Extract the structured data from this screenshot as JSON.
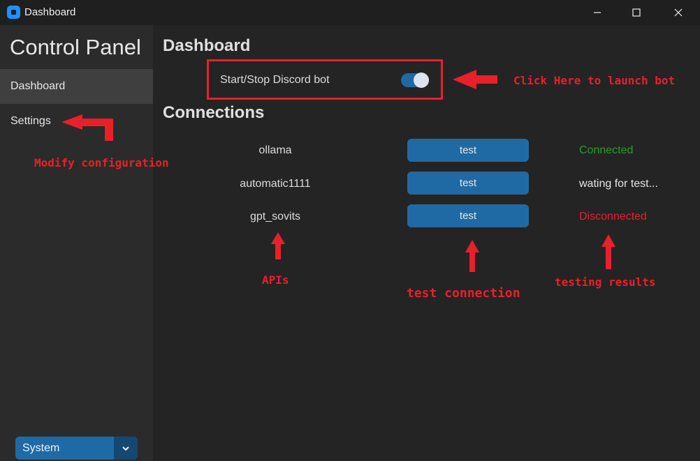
{
  "window": {
    "title": "Dashboard",
    "icon": "app-icon",
    "controls": [
      "minimize-icon",
      "maximize-icon",
      "close-icon"
    ]
  },
  "sidebar": {
    "title": "Control Panel",
    "items": [
      {
        "label": "Dashboard",
        "selected": true
      },
      {
        "label": "Settings",
        "selected": false
      }
    ],
    "appearance": {
      "value": "System",
      "icon": "chevron-down-icon"
    }
  },
  "main": {
    "dashboard_heading": "Dashboard",
    "bot_toggle": {
      "label": "Start/Stop Discord bot",
      "on": true
    },
    "connections_heading": "Connections",
    "connections": [
      {
        "api": "ollama",
        "button": "test",
        "status": "Connected",
        "status_color": "#23a023"
      },
      {
        "api": "automatic1111",
        "button": "test",
        "status": "wating for test...",
        "status_color": "#e6e6e6"
      },
      {
        "api": "gpt_sovits",
        "button": "test",
        "status": "Disconnected",
        "status_color": "#e8202a"
      }
    ]
  },
  "annotations": {
    "launch": "Click Here to launch bot",
    "configure": "Modify configuration",
    "apis": "APIs",
    "test": "test connection",
    "results": "testing results",
    "color": "#e8202a"
  },
  "colors": {
    "accent": "#1f6aa5",
    "sidebar_bg": "#2b2b2b",
    "main_bg": "#242424"
  }
}
